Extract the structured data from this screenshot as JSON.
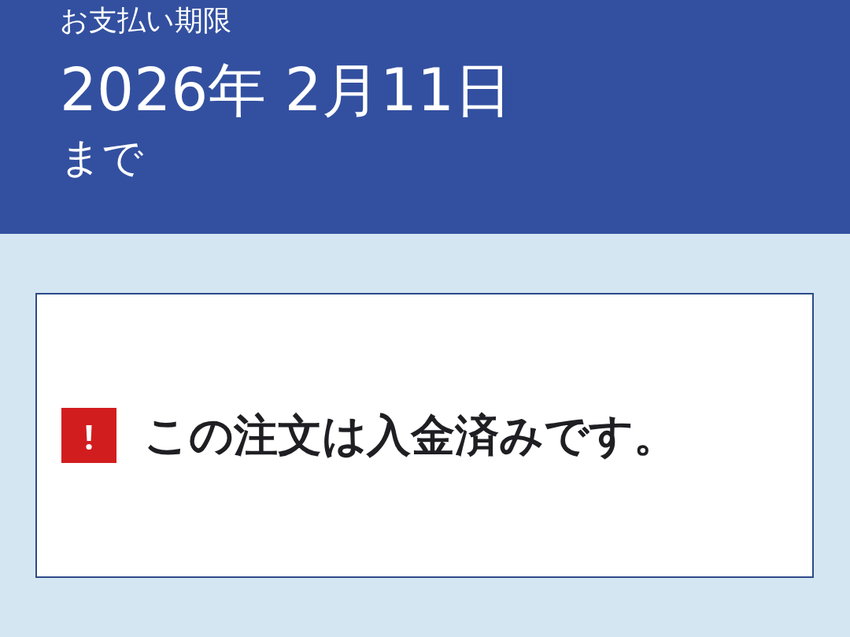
{
  "deadline": {
    "label": "お支払い期限",
    "date": "2026年 2月11日",
    "suffix": "まで"
  },
  "notice": {
    "message": "この注文は入金済みです。"
  }
}
